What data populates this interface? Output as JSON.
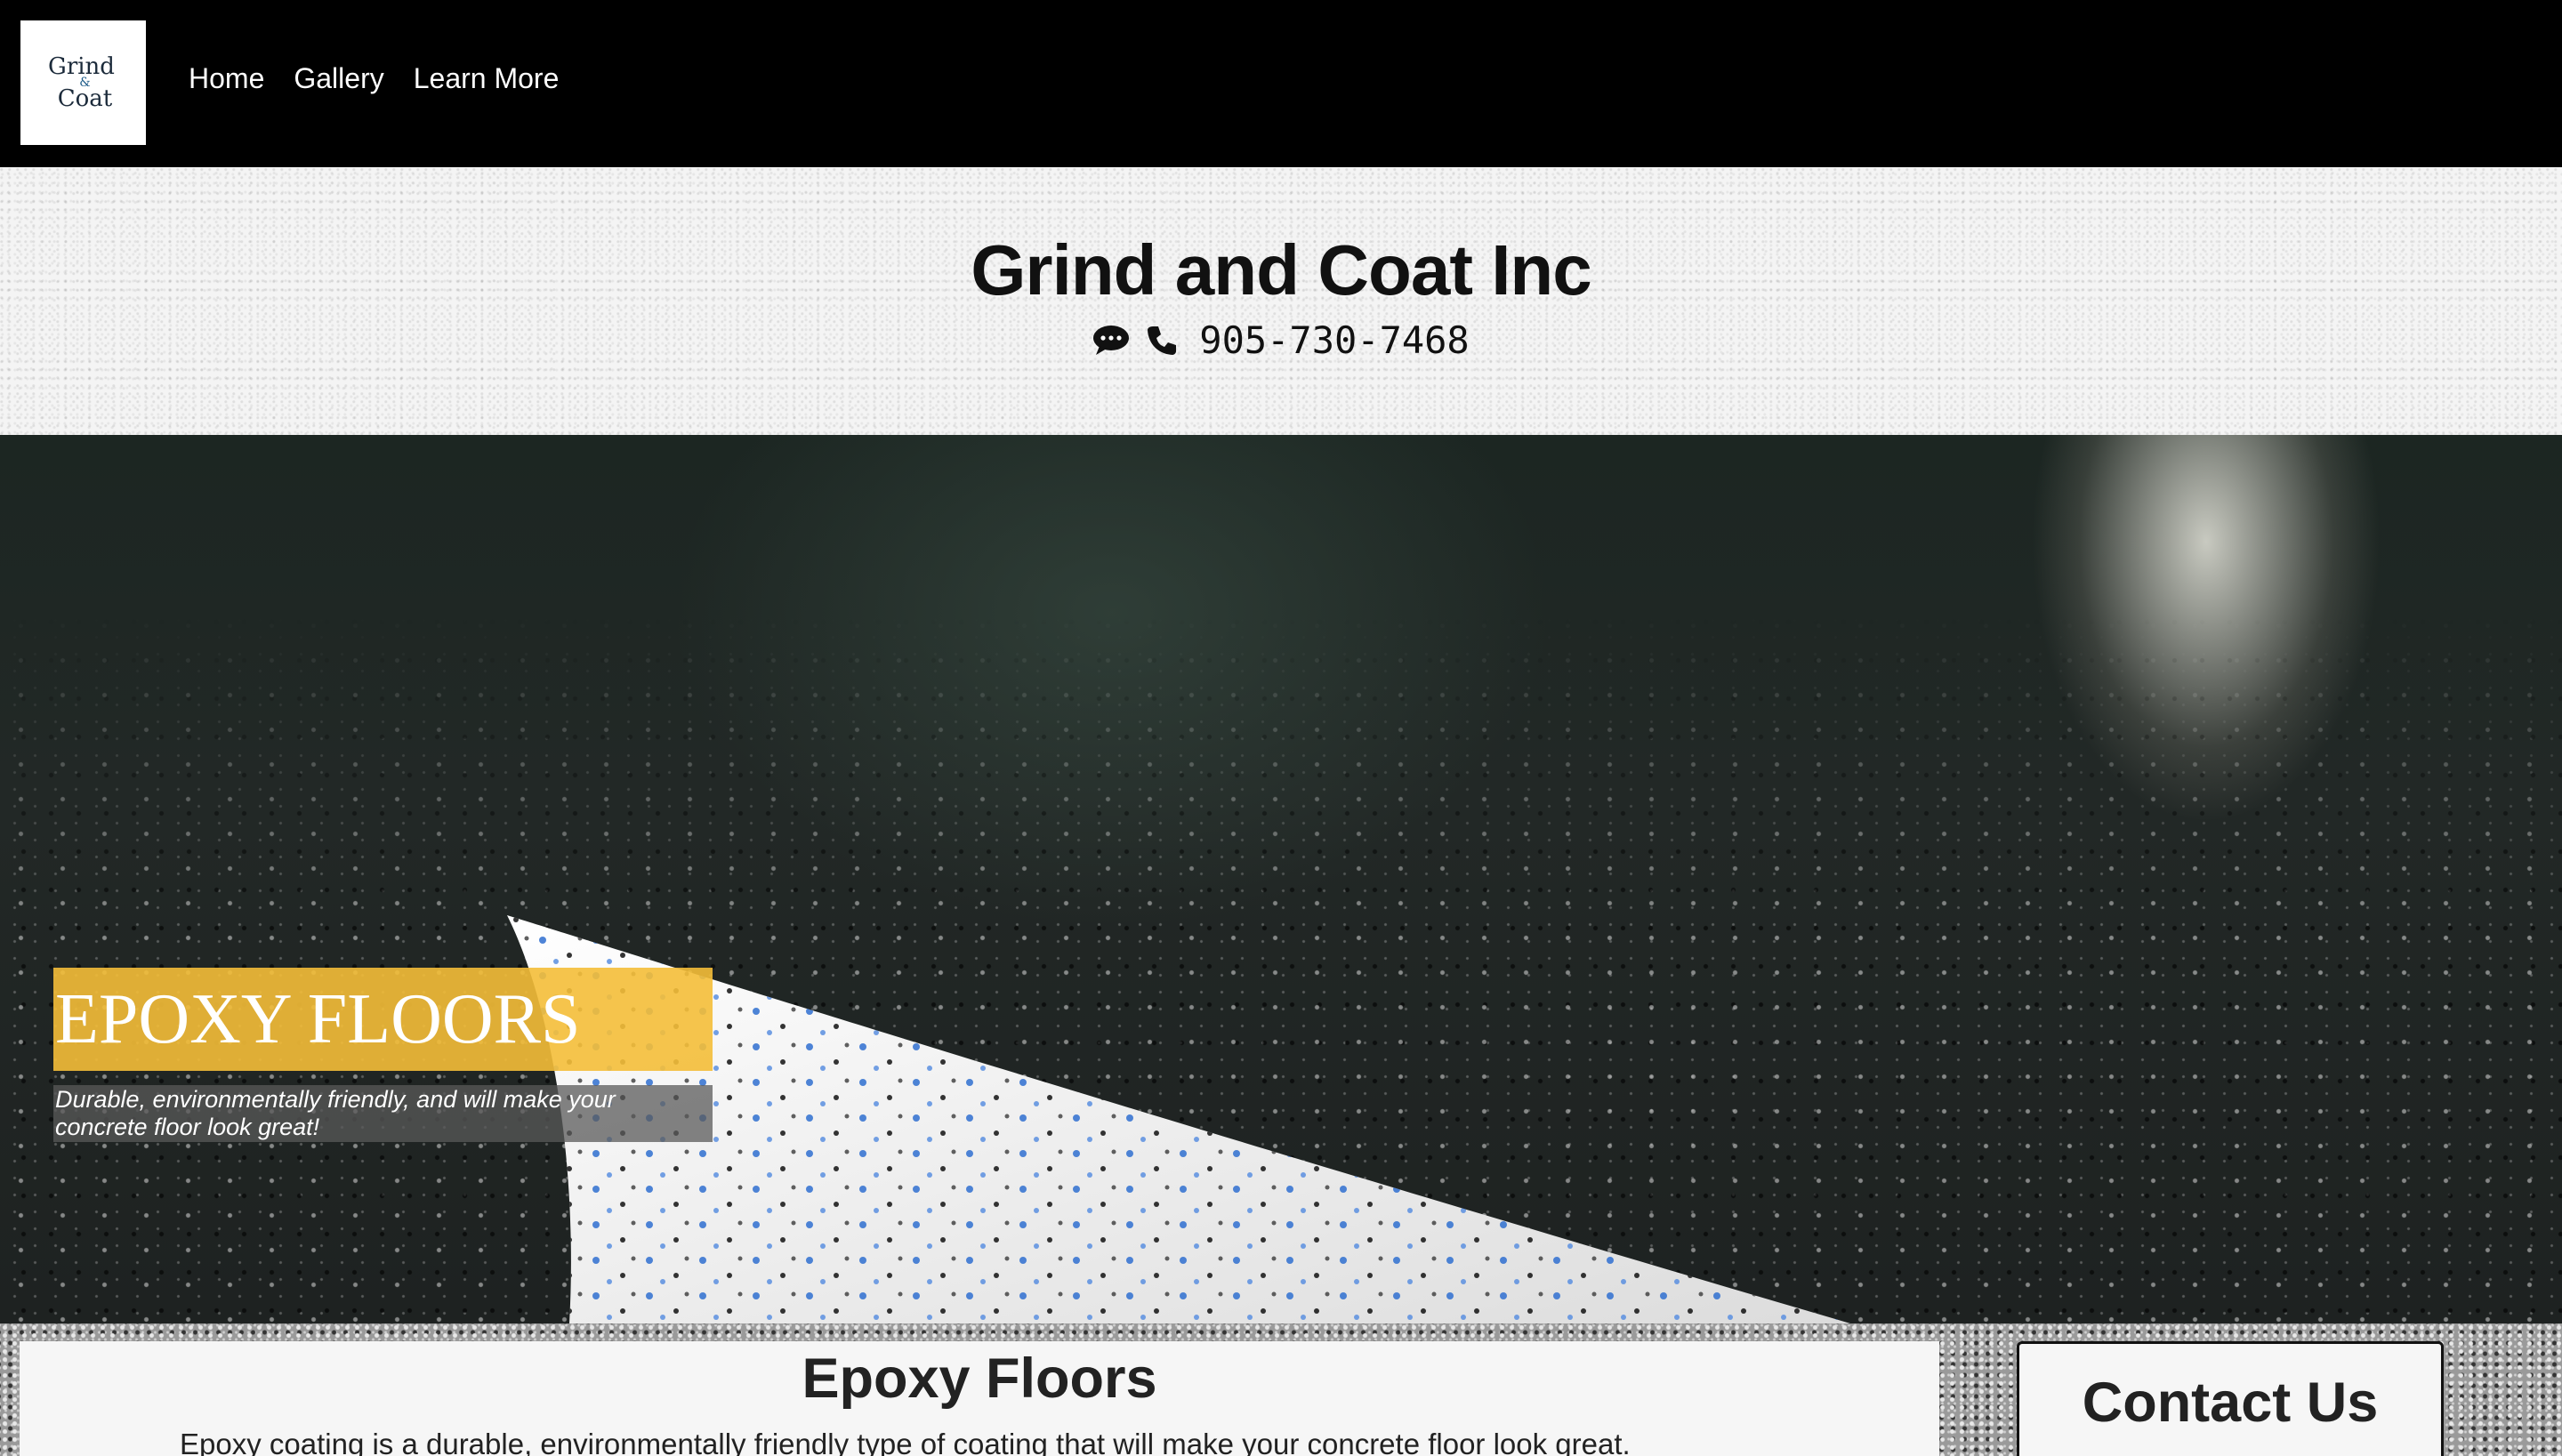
{
  "nav": {
    "logo": {
      "line1": "Grind",
      "amp": "&",
      "line2": "Coat"
    },
    "links": [
      "Home",
      "Gallery",
      "Learn More"
    ]
  },
  "header": {
    "title": "Grind and Coat Inc",
    "phone": "905-730-7468",
    "icons": [
      "chat-icon",
      "phone-icon"
    ]
  },
  "hero": {
    "title": "EPOXY FLOORS",
    "subtitle_line1": "Durable, environmentally friendly, and will make your",
    "subtitle_line2": "concrete floor look great!",
    "accent_color": "#f4be38"
  },
  "main": {
    "section_title": "Epoxy Floors",
    "intro_text": "Epoxy coating is a durable, environmentally friendly type of coating that will make your concrete floor look great."
  },
  "sidebar": {
    "contact_title": "Contact Us"
  }
}
